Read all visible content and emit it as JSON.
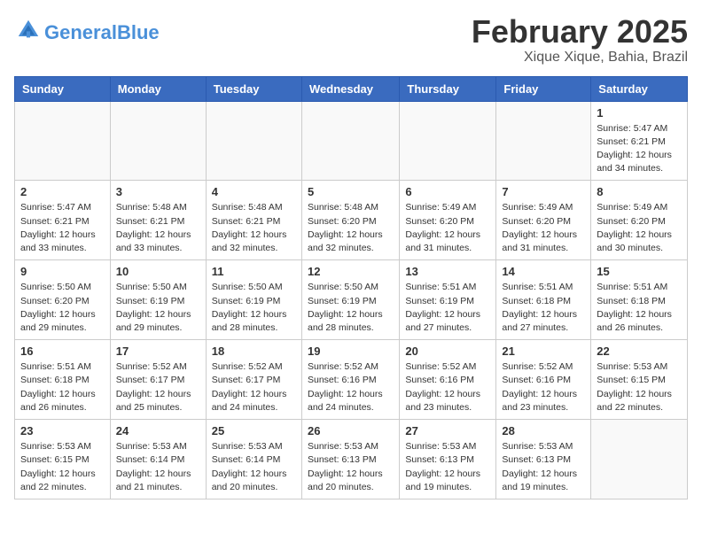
{
  "logo": {
    "text_general": "General",
    "text_blue": "Blue"
  },
  "title": "February 2025",
  "location": "Xique Xique, Bahia, Brazil",
  "weekdays": [
    "Sunday",
    "Monday",
    "Tuesday",
    "Wednesday",
    "Thursday",
    "Friday",
    "Saturday"
  ],
  "weeks": [
    [
      {
        "day": "",
        "info": ""
      },
      {
        "day": "",
        "info": ""
      },
      {
        "day": "",
        "info": ""
      },
      {
        "day": "",
        "info": ""
      },
      {
        "day": "",
        "info": ""
      },
      {
        "day": "",
        "info": ""
      },
      {
        "day": "1",
        "info": "Sunrise: 5:47 AM\nSunset: 6:21 PM\nDaylight: 12 hours\nand 34 minutes."
      }
    ],
    [
      {
        "day": "2",
        "info": "Sunrise: 5:47 AM\nSunset: 6:21 PM\nDaylight: 12 hours\nand 33 minutes."
      },
      {
        "day": "3",
        "info": "Sunrise: 5:48 AM\nSunset: 6:21 PM\nDaylight: 12 hours\nand 33 minutes."
      },
      {
        "day": "4",
        "info": "Sunrise: 5:48 AM\nSunset: 6:21 PM\nDaylight: 12 hours\nand 32 minutes."
      },
      {
        "day": "5",
        "info": "Sunrise: 5:48 AM\nSunset: 6:20 PM\nDaylight: 12 hours\nand 32 minutes."
      },
      {
        "day": "6",
        "info": "Sunrise: 5:49 AM\nSunset: 6:20 PM\nDaylight: 12 hours\nand 31 minutes."
      },
      {
        "day": "7",
        "info": "Sunrise: 5:49 AM\nSunset: 6:20 PM\nDaylight: 12 hours\nand 31 minutes."
      },
      {
        "day": "8",
        "info": "Sunrise: 5:49 AM\nSunset: 6:20 PM\nDaylight: 12 hours\nand 30 minutes."
      }
    ],
    [
      {
        "day": "9",
        "info": "Sunrise: 5:50 AM\nSunset: 6:20 PM\nDaylight: 12 hours\nand 29 minutes."
      },
      {
        "day": "10",
        "info": "Sunrise: 5:50 AM\nSunset: 6:19 PM\nDaylight: 12 hours\nand 29 minutes."
      },
      {
        "day": "11",
        "info": "Sunrise: 5:50 AM\nSunset: 6:19 PM\nDaylight: 12 hours\nand 28 minutes."
      },
      {
        "day": "12",
        "info": "Sunrise: 5:50 AM\nSunset: 6:19 PM\nDaylight: 12 hours\nand 28 minutes."
      },
      {
        "day": "13",
        "info": "Sunrise: 5:51 AM\nSunset: 6:19 PM\nDaylight: 12 hours\nand 27 minutes."
      },
      {
        "day": "14",
        "info": "Sunrise: 5:51 AM\nSunset: 6:18 PM\nDaylight: 12 hours\nand 27 minutes."
      },
      {
        "day": "15",
        "info": "Sunrise: 5:51 AM\nSunset: 6:18 PM\nDaylight: 12 hours\nand 26 minutes."
      }
    ],
    [
      {
        "day": "16",
        "info": "Sunrise: 5:51 AM\nSunset: 6:18 PM\nDaylight: 12 hours\nand 26 minutes."
      },
      {
        "day": "17",
        "info": "Sunrise: 5:52 AM\nSunset: 6:17 PM\nDaylight: 12 hours\nand 25 minutes."
      },
      {
        "day": "18",
        "info": "Sunrise: 5:52 AM\nSunset: 6:17 PM\nDaylight: 12 hours\nand 24 minutes."
      },
      {
        "day": "19",
        "info": "Sunrise: 5:52 AM\nSunset: 6:16 PM\nDaylight: 12 hours\nand 24 minutes."
      },
      {
        "day": "20",
        "info": "Sunrise: 5:52 AM\nSunset: 6:16 PM\nDaylight: 12 hours\nand 23 minutes."
      },
      {
        "day": "21",
        "info": "Sunrise: 5:52 AM\nSunset: 6:16 PM\nDaylight: 12 hours\nand 23 minutes."
      },
      {
        "day": "22",
        "info": "Sunrise: 5:53 AM\nSunset: 6:15 PM\nDaylight: 12 hours\nand 22 minutes."
      }
    ],
    [
      {
        "day": "23",
        "info": "Sunrise: 5:53 AM\nSunset: 6:15 PM\nDaylight: 12 hours\nand 22 minutes."
      },
      {
        "day": "24",
        "info": "Sunrise: 5:53 AM\nSunset: 6:14 PM\nDaylight: 12 hours\nand 21 minutes."
      },
      {
        "day": "25",
        "info": "Sunrise: 5:53 AM\nSunset: 6:14 PM\nDaylight: 12 hours\nand 20 minutes."
      },
      {
        "day": "26",
        "info": "Sunrise: 5:53 AM\nSunset: 6:13 PM\nDaylight: 12 hours\nand 20 minutes."
      },
      {
        "day": "27",
        "info": "Sunrise: 5:53 AM\nSunset: 6:13 PM\nDaylight: 12 hours\nand 19 minutes."
      },
      {
        "day": "28",
        "info": "Sunrise: 5:53 AM\nSunset: 6:13 PM\nDaylight: 12 hours\nand 19 minutes."
      },
      {
        "day": "",
        "info": ""
      }
    ]
  ]
}
